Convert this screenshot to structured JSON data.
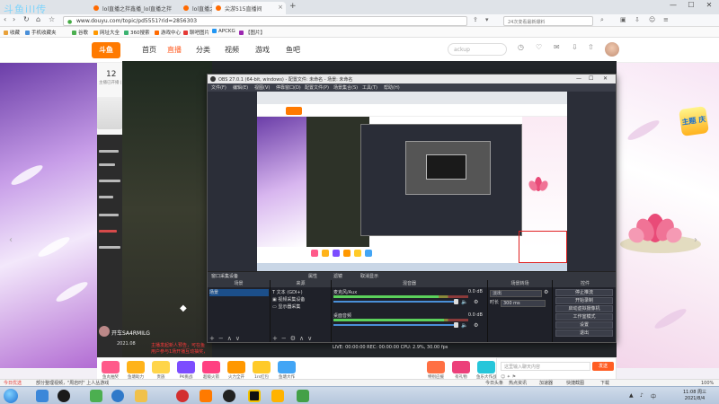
{
  "browser": {
    "watermark": "斗鱼ill传",
    "tabs": [
      {
        "label": "lol直播之拌鑫播_lol直播之拌"
      },
      {
        "label": "lol直播之拌鑫播_lol直播之拌"
      },
      {
        "label": "尖游515直播间"
      }
    ],
    "new_tab": "+",
    "window_controls": [
      "—",
      "☐",
      "✕"
    ],
    "url": "www.douyu.com/topic/pd5551?rid=2856303",
    "search_placeholder": "24次变看最新爆料",
    "bookmarks": [
      "收藏",
      "手机收藏夹",
      "谷歌",
      "网址大全",
      "360搜索",
      "游戏中心",
      "聊吧图片",
      "APCKG",
      "【图片】"
    ]
  },
  "site": {
    "logo": "斗鱼",
    "nav": [
      "首页",
      "直播",
      "分类",
      "视频",
      "游戏",
      "鱼吧"
    ],
    "search_placeholder": "ackup",
    "room_count": "12",
    "room_sub": "主播已开播 | 1号小馆",
    "streamer_name": "开车SA4RMILG",
    "streamer_date": "2021.08",
    "gift_banner": [
      "主播发起新人预告，可在鱼",
      "用户参与1场开播互动抽奖，"
    ],
    "gifts": [
      "鱼丸抽奖",
      "鱼塘助力",
      "贵族",
      "PK挑战",
      "超级火箭",
      "火力全开",
      "1rs红包",
      "鱼塘大作",
      "特别应援",
      "有礼物",
      "鱼乐大作战",
      "鱼乐大冲"
    ],
    "chat_placeholder": "这里输入聊天内容",
    "send_label": "发送",
    "chat_tools": "☺  ✦  ⚑",
    "badge_3d": "主题\n庆"
  },
  "obs": {
    "title": "OBS 27.0.1 (64-bit, windows) - 配置文件: 未命名 - 场景: 未命名",
    "menu": [
      "文件(F)",
      "编辑(E)",
      "视图(V)",
      "停靠窗口(D)",
      "配置文件(P)",
      "场景集合(S)",
      "工具(T)",
      "帮助(H)"
    ],
    "source_tabs": [
      "属性",
      "滤镜",
      "取消显示"
    ],
    "scene_label": "窗口采集设备",
    "docks": {
      "scenes": "场景",
      "sources": "来源",
      "mixer": "混音器",
      "transitions": "场景转场",
      "controls": "控件"
    },
    "scenes": [
      "场景"
    ],
    "sources": [
      "文本 (GDI+)",
      "视频采集设备",
      "显示器采集"
    ],
    "mixer_channels": [
      {
        "name": "麦克风/Aux",
        "db": "0.0 dB",
        "level": 0.78
      },
      {
        "name": "桌面音频",
        "db": "0.0 dB",
        "level": 0.82
      }
    ],
    "transition": {
      "type": "淡出",
      "duration_label": "时长",
      "duration": "300 ms"
    },
    "controls": [
      "停止推流",
      "开始录制",
      "启动虚拟摄像机",
      "工作室模式",
      "设置",
      "退出"
    ],
    "status": "LIVE: 00:00:00   REC: 00:00:00   CPU: 2.9%, 30.00 fps"
  },
  "statusline": [
    "今日优选",
    "部分整理视频，\"周岩时\" 上人丛游戏",
    "今日头条",
    "热点资讯",
    "加速器",
    "快捷截图",
    "下载",
    "100%"
  ],
  "taskbar": {
    "apps": [
      "browser",
      "qq",
      "media",
      "ie",
      "files",
      "netease",
      "screen",
      "obs",
      "record",
      "chat",
      "music",
      "wechat"
    ],
    "tray_text": "",
    "clock_time": "11:08 周三",
    "clock_date": "2021/8/4"
  },
  "colors": {
    "accent": "#ff5d23",
    "obs_bg": "#2b2e38",
    "brand_orange": "#ff7a00"
  }
}
